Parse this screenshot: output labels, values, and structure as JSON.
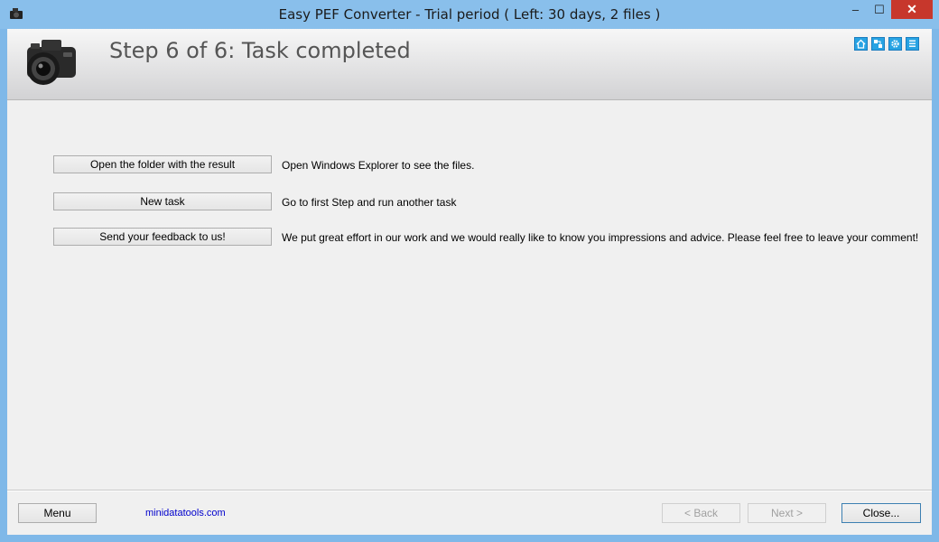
{
  "window": {
    "title": "Easy PEF Converter - Trial period ( Left: 30 days, 2 files )",
    "controls": {
      "minimize": "–",
      "maximize": "☐",
      "close": "✕"
    }
  },
  "header": {
    "step_title": "Step 6 of 6: Task completed",
    "tool_icons": [
      "home-icon",
      "network-icon",
      "gear-icon",
      "list-icon"
    ]
  },
  "actions": [
    {
      "label": "Open the folder with the result",
      "description": "Open Windows Explorer to see the files."
    },
    {
      "label": "New task",
      "description": "Go to first Step and run another task"
    },
    {
      "label": "Send your feedback to us!",
      "description": "We put great effort in our work and we would really like to know you impressions and advice. Please feel free to leave your comment!"
    }
  ],
  "footer": {
    "menu_label": "Menu",
    "link_text": "minidatatools.com",
    "back_label": "< Back",
    "next_label": "Next >",
    "close_label": "Close..."
  },
  "colors": {
    "titlebar": "#89bfeb",
    "close_button": "#c7372c",
    "link": "#0000cc",
    "tool_icon": "#27a3e3"
  }
}
